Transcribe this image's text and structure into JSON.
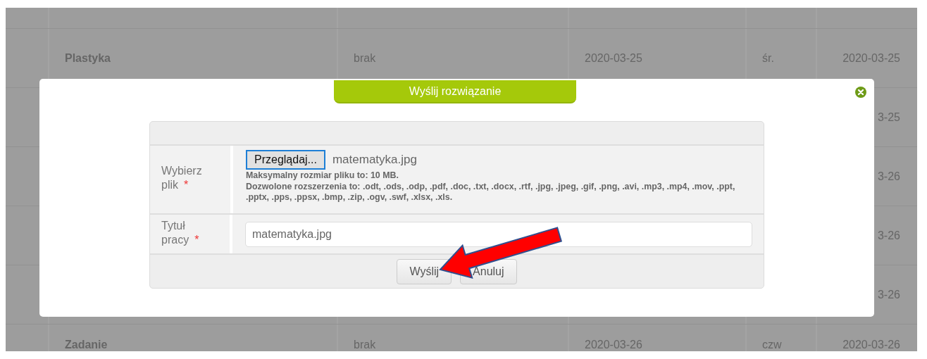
{
  "table": {
    "rows": [
      {
        "cells": [
          "",
          "",
          "",
          "",
          ""
        ]
      },
      {
        "cells": [
          "Plastyka",
          "brak",
          "2020-03-25",
          "śr.",
          "2020-03-25"
        ]
      },
      {
        "cells": [
          "",
          "",
          "",
          "",
          "3-25"
        ]
      },
      {
        "cells": [
          "",
          "",
          "",
          "",
          "3-26"
        ]
      },
      {
        "cells": [
          "",
          "",
          "",
          "",
          "3-26"
        ]
      },
      {
        "cells": [
          "",
          "",
          "",
          "",
          "3-26"
        ]
      },
      {
        "cells": [
          "Zadanie",
          "brak",
          "2020-03-26",
          "czw",
          "2020-03-26"
        ]
      }
    ]
  },
  "dialog": {
    "title": "Wyślij rozwiązanie",
    "fields": [
      {
        "kind": "file",
        "label": "Wybierz plik",
        "required_mark": "*",
        "button": "Przeglądaj...",
        "value": "matematyka.jpg",
        "hints": [
          "Maksymalny rozmiar pliku to: 10 MB.",
          "Dozwolone rozszerzenia to: .odt, .ods, .odp, .pdf, .doc, .txt, .docx, .rtf, .jpg, .jpeg, .gif, .png, .avi, .mp3, .mp4, .mov, .ppt, .pptx, .pps, .ppsx, .bmp, .zip, .ogv, .swf, .xlsx, .xls."
        ]
      },
      {
        "kind": "text",
        "label": "Tytuł pracy",
        "required_mark": "*",
        "value": "matematyka.jpg"
      }
    ],
    "buttons": [
      "Wyślij",
      "Anuluj"
    ]
  }
}
